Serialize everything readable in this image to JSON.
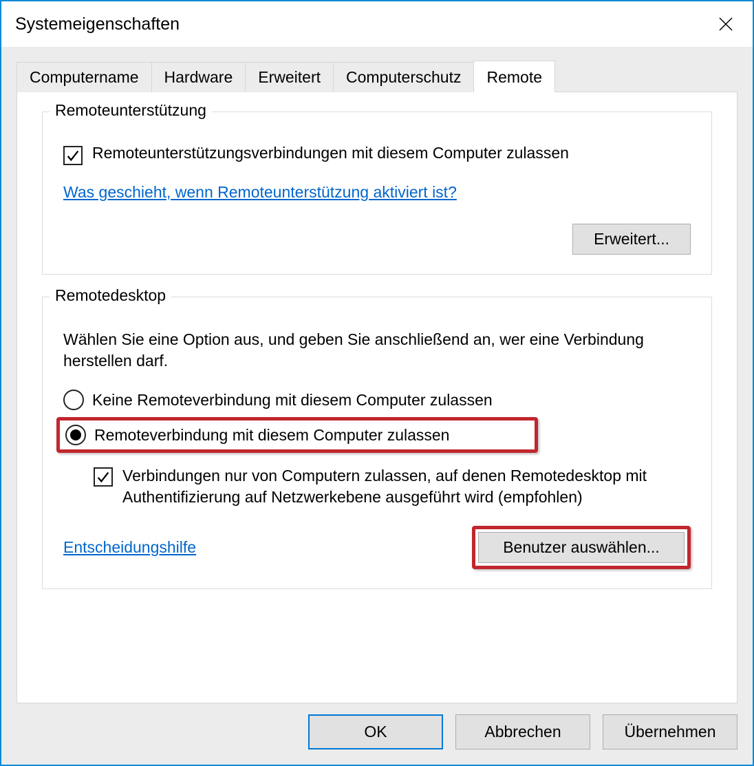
{
  "window": {
    "title": "Systemeigenschaften"
  },
  "tabs": {
    "computer_name": "Computername",
    "hardware": "Hardware",
    "advanced": "Erweitert",
    "protection": "Computerschutz",
    "remote": "Remote"
  },
  "remote_assistance": {
    "group_title": "Remoteunterstützung",
    "allow_label": "Remoteunterstützungsverbindungen mit diesem Computer zulassen",
    "help_link": "Was geschieht, wenn Remoteunterstützung aktiviert ist?",
    "advanced_button": "Erweitert..."
  },
  "remote_desktop": {
    "group_title": "Remotedesktop",
    "description": "Wählen Sie eine Option aus, und geben Sie anschließend an, wer eine Verbindung herstellen darf.",
    "option_no": "Keine Remoteverbindung mit diesem Computer zulassen",
    "option_yes": "Remoteverbindung mit diesem Computer zulassen",
    "nla_label": "Verbindungen nur von Computern zulassen, auf denen Remotedesktop mit Authentifizierung auf Netzwerkebene ausgeführt wird (empfohlen)",
    "help_link": "Entscheidungshilfe",
    "select_users_button": "Benutzer auswählen..."
  },
  "buttons": {
    "ok": "OK",
    "cancel": "Abbrechen",
    "apply": "Übernehmen"
  }
}
